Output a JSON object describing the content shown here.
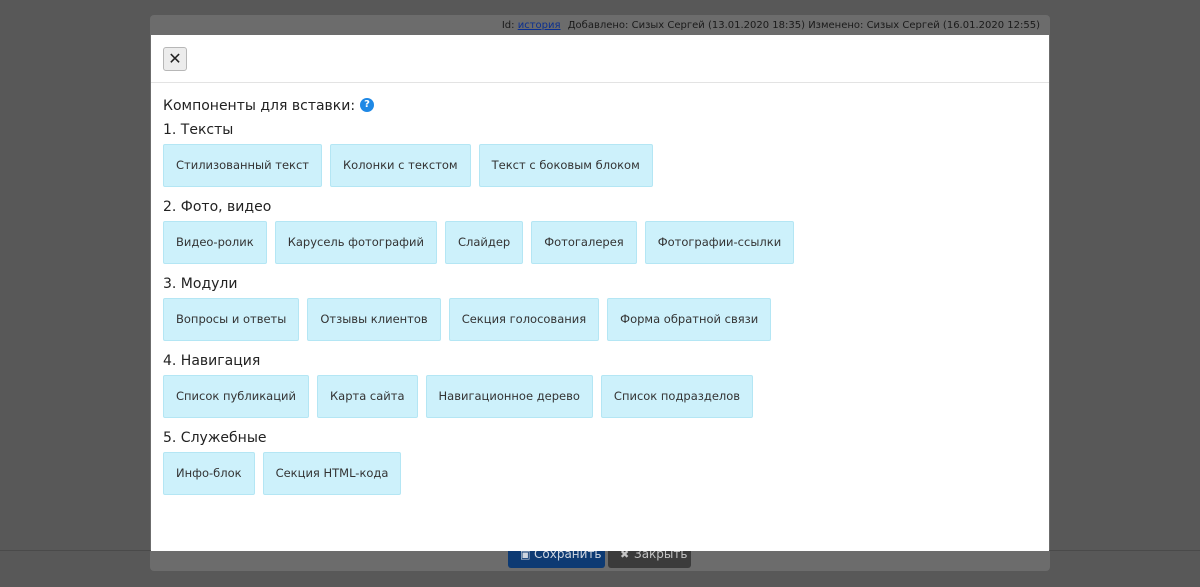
{
  "meta": {
    "id_label": "Id:",
    "id_link": "история",
    "added": "Добавлено: Сизых Сергей (13.01.2020 18:35)",
    "changed": "Изменено: Сизых Сергей (16.01.2020 12:55)"
  },
  "footer": {
    "save_label": "Сохранить",
    "close_label": "Закрыть",
    "save_icon": "floppy-icon",
    "close_icon": "x-icon"
  },
  "modal": {
    "close_glyph": "✕",
    "heading": "Компоненты для вставки:",
    "help_glyph": "?",
    "help_color": "#1e88e5",
    "button_color": "#cdf1fb",
    "sections": [
      {
        "title": "1. Тексты",
        "buttons": [
          "Стилизованный текст",
          "Колонки с текстом",
          "Текст с боковым блоком"
        ]
      },
      {
        "title": "2. Фото, видео",
        "buttons": [
          "Видео-ролик",
          "Карусель фотографий",
          "Слайдер",
          "Фотогалерея",
          "Фотографии-ссылки"
        ]
      },
      {
        "title": "3. Модули",
        "buttons": [
          "Вопросы и ответы",
          "Отзывы клиентов",
          "Секция голосования",
          "Форма обратной связи"
        ]
      },
      {
        "title": "4. Навигация",
        "buttons": [
          "Список публикаций",
          "Карта сайта",
          "Навигационное дерево",
          "Список подразделов"
        ]
      },
      {
        "title": "5. Служебные",
        "buttons": [
          "Инфо-блок",
          "Секция HTML-кода"
        ]
      }
    ]
  }
}
